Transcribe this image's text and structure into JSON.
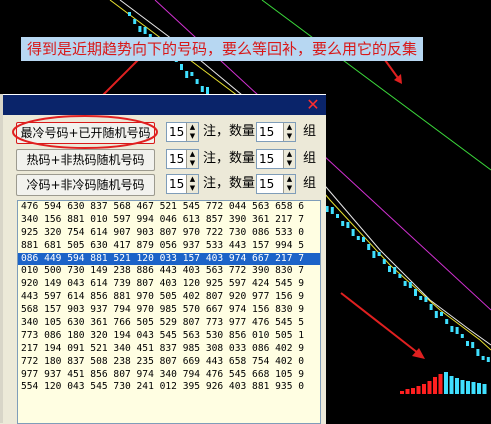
{
  "annotation": {
    "text": "得到是近期趋势向下的号码，要么等回补，要么用它的反集"
  },
  "dialog": {
    "close_glyph": "✕",
    "rows": [
      {
        "button": "最冷号码+已开随机号码",
        "count": "15",
        "count_unit": "注，数量",
        "qty": "15",
        "qty_unit": "组"
      },
      {
        "button": "热码+非热码随机号码",
        "count": "15",
        "count_unit": "注，数量",
        "qty": "15",
        "qty_unit": "组"
      },
      {
        "button": "冷码+非冷码随机号码",
        "count": "15",
        "count_unit": "注，数量",
        "qty": "15",
        "qty_unit": "组"
      }
    ],
    "output_lines": [
      "476 594 630 837 568 467 521 545 772 044 563 658 6",
      "340 156 881 010 597 994 046 613 857 390 361 217 7",
      "925 320 754 614 907 903 807 970 722 730 086 533 0",
      "881 681 505 630 417 879 056 937 533 443 157 994 5",
      "086 449 594 881 521 120 033 157 403 974 667 217 7",
      "010 500 730 149 238 886 443 403 563 772 390 830 7",
      "920 149 043 614 739 807 403 120 925 597 424 545 9",
      "443 597 614 856 881 970 505 402 807 920 977 156 9",
      "568 157 903 937 794 970 985 570 667 974 156 830 9",
      "340 105 630 361 766 505 529 807 773 977 476 545 5",
      "773 086 180 320 194 043 545 563 530 856 010 505 1",
      "217 194 091 521 340 451 837 985 308 033 086 402 9",
      "772 180 837 508 238 235 807 669 443 658 754 402 0",
      "977 937 451 856 807 974 340 794 476 545 668 105 9",
      "554 120 043 545 730 241 012 395 926 403 881 935 0"
    ],
    "selected_line": 4
  },
  "colors": {
    "annotation_text": "#d81818",
    "annotation_bg": "#b7d7f2",
    "arrow": "#e02020",
    "candle_up": "#ff2020",
    "candle_down": "#40e0ff",
    "selection": "#1c63c8",
    "output_bg": "#fffee2"
  }
}
